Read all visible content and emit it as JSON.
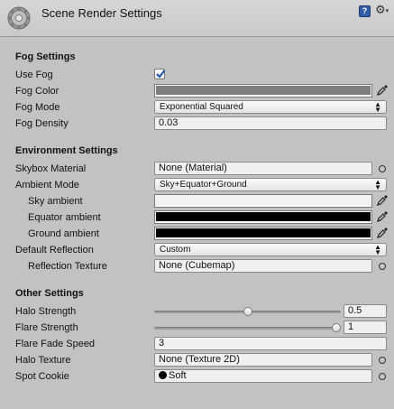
{
  "header": {
    "title": "Scene Render Settings",
    "help_glyph": "?",
    "gear_glyph": "⚙",
    "caret_glyph": "▾"
  },
  "fog": {
    "section_title": "Fog Settings",
    "use_fog_label": "Use Fog",
    "use_fog_checked": true,
    "fog_color_label": "Fog Color",
    "fog_color": "#7f7f7f",
    "fog_mode_label": "Fog Mode",
    "fog_mode_value": "Exponential Squared",
    "fog_density_label": "Fog Density",
    "fog_density_value": "0.03"
  },
  "environment": {
    "section_title": "Environment Settings",
    "skybox_label": "Skybox Material",
    "skybox_value": "None (Material)",
    "ambient_mode_label": "Ambient Mode",
    "ambient_mode_value": "Sky+Equator+Ground",
    "sky_ambient_label": "Sky ambient",
    "sky_ambient_color": "#f2f2f2",
    "equator_ambient_label": "Equator ambient",
    "equator_ambient_color": "#000000",
    "ground_ambient_label": "Ground ambient",
    "ground_ambient_color": "#000000",
    "default_reflection_label": "Default Reflection",
    "default_reflection_value": "Custom",
    "reflection_texture_label": "Reflection Texture",
    "reflection_texture_value": "None (Cubemap)"
  },
  "other": {
    "section_title": "Other Settings",
    "halo_strength_label": "Halo Strength",
    "halo_strength_value": "0.5",
    "halo_strength_fraction": 0.5,
    "flare_strength_label": "Flare Strength",
    "flare_strength_value": "1",
    "flare_strength_fraction": 1.0,
    "flare_fade_label": "Flare Fade Speed",
    "flare_fade_value": "3",
    "halo_texture_label": "Halo Texture",
    "halo_texture_value": "None (Texture 2D)",
    "spot_cookie_label": "Spot Cookie",
    "spot_cookie_value": "Soft"
  },
  "icons": {
    "dropdown_arrows": "▲▼",
    "component": "gear-icon",
    "eyedropper": "eyedropper-icon",
    "object_picker": "object-picker-icon"
  }
}
